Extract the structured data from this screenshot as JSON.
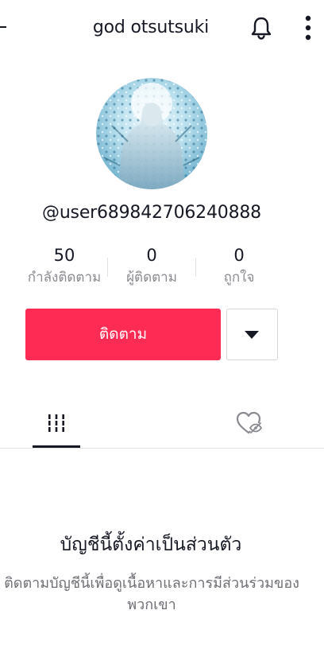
{
  "header": {
    "title": "god otsutsuki",
    "back_icon": "back-arrow-icon",
    "notification_icon": "bell-icon",
    "menu_icon": "more-vertical-icon"
  },
  "profile": {
    "username": "@user689842706240888"
  },
  "stats": [
    {
      "value": "50",
      "label": "กำลังติดตาม"
    },
    {
      "value": "0",
      "label": "ผู้ติดตาม"
    },
    {
      "value": "0",
      "label": "ถูกใจ"
    }
  ],
  "actions": {
    "follow_label": "ติดตาม",
    "dropdown_icon": "caret-down-icon"
  },
  "tabs": [
    {
      "name": "videos",
      "icon": "grid-icon",
      "active": true
    },
    {
      "name": "liked",
      "icon": "heart-hidden-icon",
      "active": false
    }
  ],
  "private_notice": {
    "title": "บัญชีนี้ตั้งค่าเป็นส่วนตัว",
    "description": "ติดตามบัญชีนี้เพื่อดูเนื้อหาและการมีส่วนร่วมของพวกเขา"
  },
  "colors": {
    "accent": "#fe2c55",
    "text": "#161823",
    "muted": "#8a8b91"
  }
}
